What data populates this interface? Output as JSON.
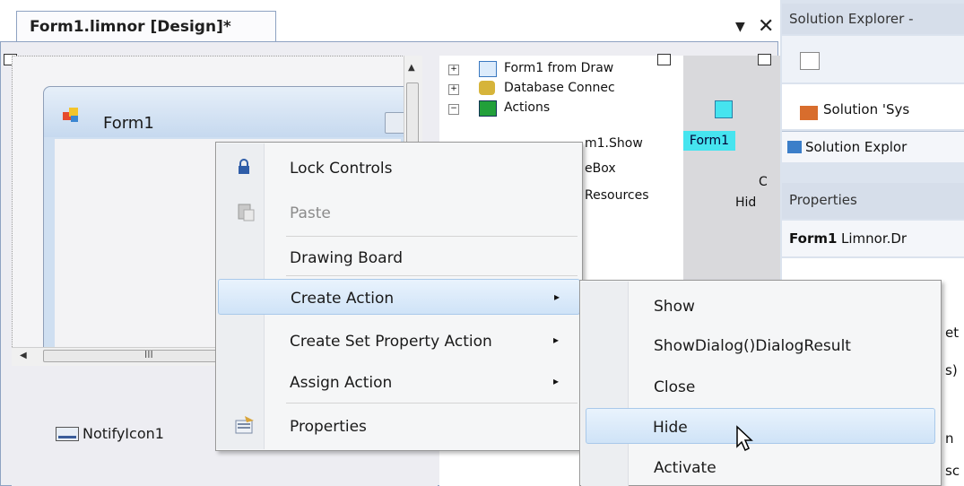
{
  "designer_tab": {
    "title": "Form1.limnor [Design]*",
    "dropdown_icon": "dropdown-arrow-icon",
    "close_icon": "close-icon"
  },
  "form": {
    "title": "Form1"
  },
  "scrollbar": {
    "grip": "III"
  },
  "tray": {
    "notify_label": "NotifyIcon1"
  },
  "tree": {
    "items": [
      {
        "label": "Form1 from Draw"
      },
      {
        "label": "Database Connec"
      },
      {
        "label": "Actions"
      },
      {
        "label": "m1.Show"
      },
      {
        "label": "eBox"
      },
      {
        "label": "Resources"
      }
    ]
  },
  "graypane": {
    "form_label": "Form1",
    "text_c": "C",
    "text_hide": "Hid"
  },
  "solution_explorer": {
    "header": "Solution Explorer -",
    "solution_item": "Solution 'Sys",
    "tab_label": "Solution Explor"
  },
  "properties": {
    "header": "Properties",
    "object_name": "Form1",
    "object_type": "Limnor.Dr",
    "row_set": "et",
    "row_s": "s)",
    "row_n": "n",
    "row_sc": "sc"
  },
  "context_menu": {
    "items": [
      {
        "label": "Lock Controls",
        "icon": "lock-icon"
      },
      {
        "label": "Paste",
        "icon": "paste-icon"
      },
      {
        "label": "Drawing Board"
      },
      {
        "label": "Create Action",
        "arrow": "▸"
      },
      {
        "label": "Create Set Property Action",
        "arrow": "▸"
      },
      {
        "label": "Assign Action",
        "arrow": "▸"
      },
      {
        "label": "Properties",
        "icon": "properties-icon"
      }
    ]
  },
  "submenu": {
    "items": [
      {
        "label": "Show"
      },
      {
        "label": "ShowDialog()DialogResult"
      },
      {
        "label": "Close"
      },
      {
        "label": "Hide"
      },
      {
        "label": "Activate"
      }
    ]
  }
}
